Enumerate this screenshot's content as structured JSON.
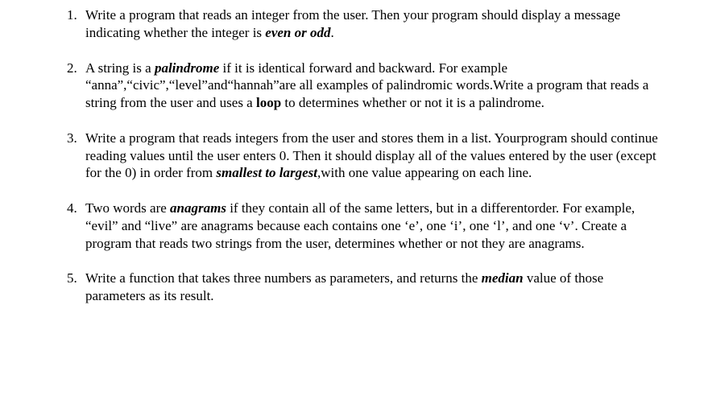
{
  "exercises": [
    {
      "p1a": "Write a program that reads an integer from the user. Then your program should display a message indicating whether the integer is ",
      "p1b_bi": "even or odd",
      "p1c": "."
    },
    {
      "p2a": "A string is a ",
      "p2b_bi": "palindrome",
      "p2c": " if it is identical forward and backward. For example “anna”,“civic”,“level”and“hannah”are all examples of palindromic words.Write a program that reads a string from the user and uses a ",
      "p2d_b": "loop",
      "p2e": " to determines whether or not it is a palindrome."
    },
    {
      "p3a": "Write a program that reads integers from the user and stores them in a list. Yourprogram should continue reading values until the user enters 0. Then it should display all of the values entered by the user (except for the 0) in order from ",
      "p3b_bi": "smallest to largest",
      "p3c": ",with one value appearing on each line."
    },
    {
      "p4a": "Two words are ",
      "p4b_bi": "anagrams",
      "p4c": " if they contain all of the same letters, but in a differentorder. For example, “evil” and “live” are anagrams because each contains one ‘e’, one ‘i’, one ‘l’, and one ‘v’. Create a program that reads two strings from the user, determines whether or not they are anagrams."
    },
    {
      "p5a": "Write a function that takes three numbers as parameters, and returns the ",
      "p5b_bi": "median",
      "p5c": " value of those parameters as its result."
    }
  ]
}
